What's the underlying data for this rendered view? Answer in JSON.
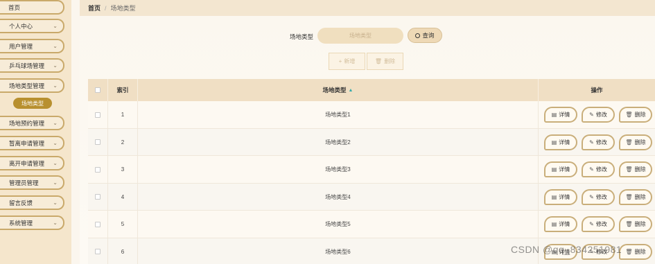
{
  "sidebar": {
    "items": [
      {
        "label": "首页",
        "has_chevron": false
      },
      {
        "label": "个人中心",
        "has_chevron": true
      },
      {
        "label": "用户管理",
        "has_chevron": true
      },
      {
        "label": "乒乓球场管理",
        "has_chevron": true
      },
      {
        "label": "场地类型管理",
        "has_chevron": true
      },
      {
        "label": "场地预约管理",
        "has_chevron": true
      },
      {
        "label": "暂离申请管理",
        "has_chevron": true
      },
      {
        "label": "离开申请管理",
        "has_chevron": true
      },
      {
        "label": "管理员管理",
        "has_chevron": true
      },
      {
        "label": "留言反馈",
        "has_chevron": true
      },
      {
        "label": "系统管理",
        "has_chevron": true
      }
    ],
    "active_sub": "场地类型"
  },
  "breadcrumb": {
    "home": "首页",
    "separator": "/",
    "current": "场地类型"
  },
  "search": {
    "label": "场地类型",
    "placeholder": "场地类型",
    "button": "查询"
  },
  "toolbar": {
    "add": "新增",
    "delete": "删除"
  },
  "table": {
    "headers": {
      "index": "索引",
      "type": "场地类型",
      "actions": "操作"
    },
    "rows": [
      {
        "index": "1",
        "type": "场地类型1"
      },
      {
        "index": "2",
        "type": "场地类型2"
      },
      {
        "index": "3",
        "type": "场地类型3"
      },
      {
        "index": "4",
        "type": "场地类型4"
      },
      {
        "index": "5",
        "type": "场地类型5"
      },
      {
        "index": "6",
        "type": "场地类型6"
      }
    ],
    "action_labels": {
      "detail": "详情",
      "edit": "修改",
      "delete": "删除"
    }
  },
  "watermark": "CSDN @qq_834251981",
  "colors": {
    "sidebar_bg": "#f5e6cc",
    "accent": "#b8902f",
    "border": "#c9a96a"
  }
}
